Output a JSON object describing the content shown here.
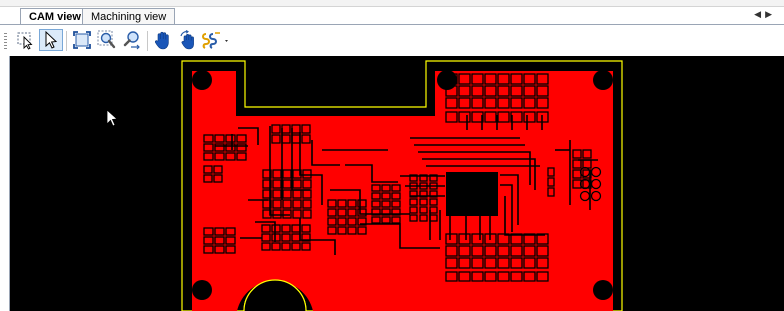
{
  "tabs": [
    {
      "label": "CAM view",
      "active": true
    },
    {
      "label": "Machining view",
      "active": false
    }
  ],
  "tab_nav": {
    "prev_icon": "triangle-left-icon",
    "next_icon": "triangle-right-icon"
  },
  "toolbar": {
    "tools": [
      {
        "name": "rect-select-tool",
        "icon": "dashed-select-arrow-icon",
        "selected": false
      },
      {
        "name": "pointer-tool",
        "icon": "arrow-pointer-icon",
        "selected": true
      },
      {
        "name": "zoom-fit-tool",
        "icon": "zoom-extents-icon",
        "selected": false
      },
      {
        "name": "zoom-window-tool",
        "icon": "zoom-window-icon",
        "selected": false
      },
      {
        "name": "zoom-pan-tool",
        "icon": "zoom-arrows-icon",
        "selected": false
      },
      {
        "name": "pan-hand-tool",
        "icon": "hand-icon",
        "selected": false
      },
      {
        "name": "rotate-hand-tool",
        "icon": "rotate-hand-icon",
        "selected": false
      },
      {
        "name": "path-tool",
        "icon": "path-dropdown-icon",
        "selected": false
      }
    ]
  },
  "colors": {
    "board_fill": "#ff0000",
    "board_outline": "#ffff00",
    "background": "#000000",
    "trace": "#000000",
    "tab_border": "#9aa5b5",
    "selected_tool_bg": "#dbeaf9"
  }
}
